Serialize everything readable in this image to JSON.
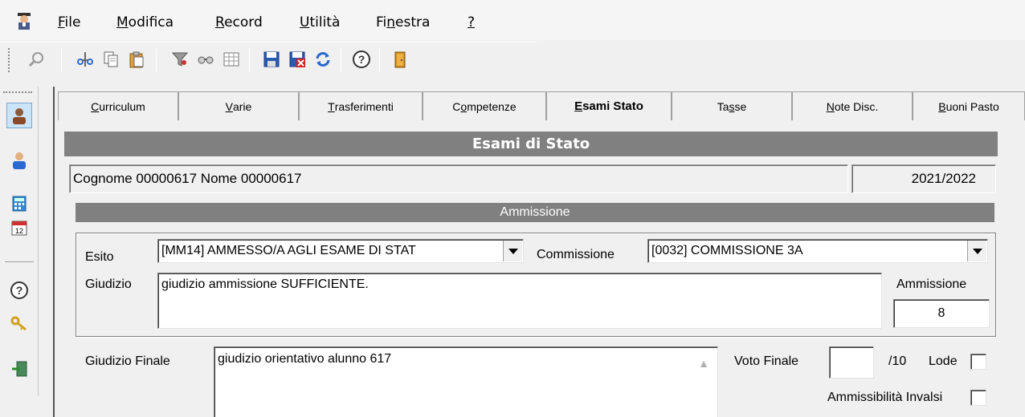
{
  "menu": {
    "items": [
      {
        "pre": "",
        "ul": "F",
        "post": "ile"
      },
      {
        "pre": "",
        "ul": "M",
        "post": "odifica"
      },
      {
        "pre": "",
        "ul": "R",
        "post": "ecord"
      },
      {
        "pre": "",
        "ul": "U",
        "post": "tilità"
      },
      {
        "pre": "Fi",
        "ul": "n",
        "post": "estra"
      },
      {
        "pre": "",
        "ul": "?",
        "post": ""
      }
    ]
  },
  "toolbar": {
    "buttons": [
      "search-icon",
      "cut-icon",
      "copy-icon",
      "paste-icon",
      "filter-icon",
      "glasses-icon",
      "grid-icon",
      "save-icon",
      "delete-icon",
      "refresh-icon",
      "help-icon",
      "exit-icon"
    ]
  },
  "sidebar": {
    "buttons": [
      "student-icon",
      "person-icon",
      "calculator-icon",
      "calendar-icon",
      "help-icon",
      "keys-icon",
      "exit-icon"
    ]
  },
  "tabs": [
    {
      "pre": "",
      "ul": "C",
      "post": "urriculum"
    },
    {
      "pre": "",
      "ul": "V",
      "post": "arie"
    },
    {
      "pre": "",
      "ul": "T",
      "post": "rasferimenti"
    },
    {
      "pre": "C",
      "ul": "o",
      "post": "mpetenze"
    },
    {
      "pre": "",
      "ul": "E",
      "post": "sami Stato"
    },
    {
      "pre": "Ta",
      "ul": "s",
      "post": "se"
    },
    {
      "pre": "",
      "ul": "N",
      "post": "ote Disc."
    },
    {
      "pre": "",
      "ul": "B",
      "post": "uoni Pasto"
    }
  ],
  "page": {
    "title": "Esami di Stato",
    "student_name": "Cognome 00000617 Nome 00000617",
    "school_year": "2021/2022",
    "section_title": "Ammissione"
  },
  "ammissione": {
    "esito_label": "Esito",
    "esito_value": "[MM14] AMMESSO/A AGLI ESAME DI STAT",
    "commissione_label": "Commissione",
    "commissione_value": "[0032] COMMISSIONE 3A",
    "giudizio_label": "Giudizio",
    "giudizio_value": "giudizio ammissione SUFFICIENTE.",
    "ammissione_label": "Ammissione",
    "ammissione_value": "8"
  },
  "finale": {
    "giudizio_finale_label": "Giudizio Finale",
    "giudizio_finale_value": "giudizio orientativo alunno 617",
    "voto_finale_label": "Voto Finale",
    "voto_finale_value": "",
    "voto_suffix": "/10",
    "lode_label": "Lode",
    "invalsi_label": "Ammissibilità Invalsi"
  }
}
